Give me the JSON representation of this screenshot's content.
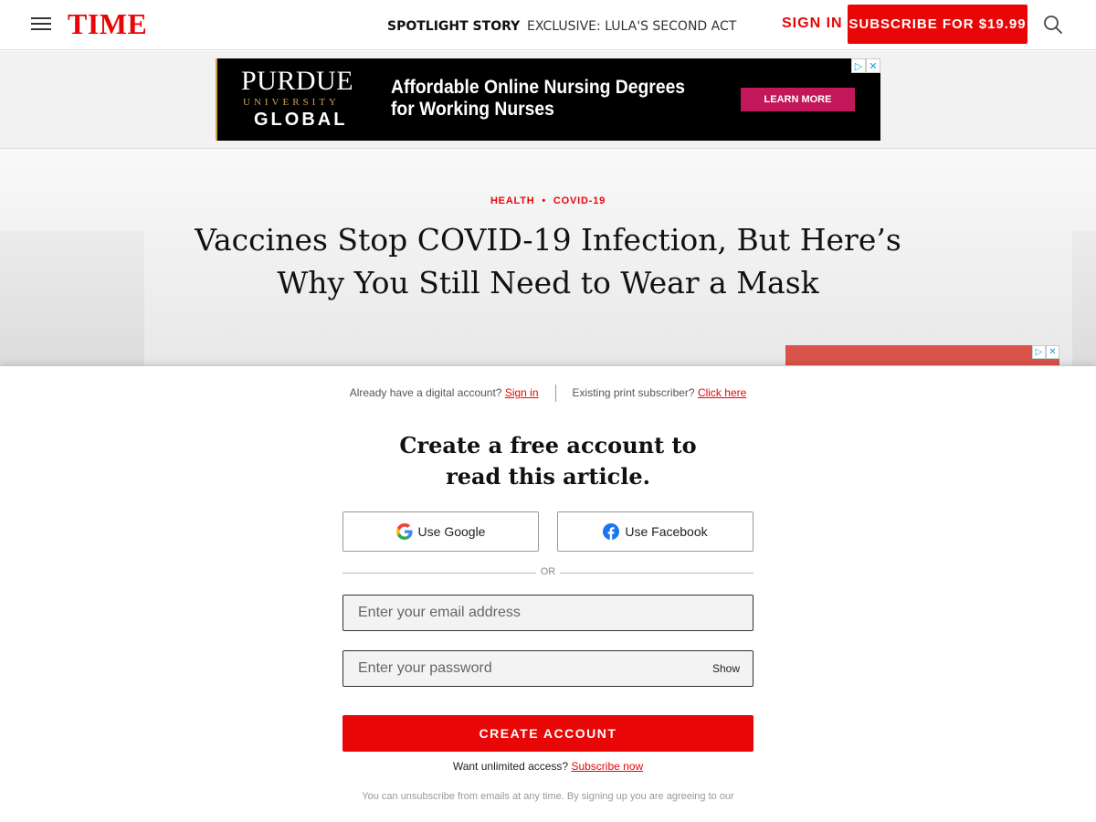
{
  "header": {
    "logo": "TIME",
    "spotlight_kicker": "SPOTLIGHT STORY",
    "spotlight_story": "EXCLUSIVE: LULA'S SECOND ACT",
    "sign_in_label": "SIGN IN",
    "subscribe_label": "SUBSCRIBE FOR $19.99",
    "menu_icon": "hamburger-menu-icon",
    "search_icon": "search-icon",
    "brand_color": "#e90606"
  },
  "ad_banner": {
    "brand_top": "PURDUE",
    "brand_mid": "UNIVERSITY",
    "brand_bottom": "GLOBAL",
    "headline_line1": "Affordable Online Nursing Degrees",
    "headline_line2": "for Working Nurses",
    "cta": "LEARN MORE",
    "adchoices_icon": "adchoices-icon",
    "close_icon": "close-icon",
    "adchoices_glyph": "▷",
    "close_glyph": "✕"
  },
  "article": {
    "tag_1": "HEALTH",
    "tag_separator": "•",
    "tag_2": "COVID-19",
    "headline_line1": "Vaccines Stop COVID-19 Infection, But Here’s",
    "headline_line2": "Why You Still Need to Wear a Mask"
  },
  "registration": {
    "digital_prompt": "Already have a digital account?",
    "digital_link": "Sign in",
    "print_prompt": "Existing print subscriber?",
    "print_link": "Click here",
    "title_line1": "Create a free account to",
    "title_line2": "read this article.",
    "google_label": "Use Google",
    "facebook_label": "Use Facebook",
    "or_label": "OR",
    "email_placeholder": "Enter your email address",
    "email_value": "",
    "password_placeholder": "Enter your password",
    "password_value": "",
    "show_label": "Show",
    "create_label": "CREATE ACCOUNT",
    "unlimited_prompt": "Want unlimited access?",
    "unlimited_link": "Subscribe now",
    "disclaimer": "You can unsubscribe from emails at any time. By signing up you are agreeing to our"
  }
}
